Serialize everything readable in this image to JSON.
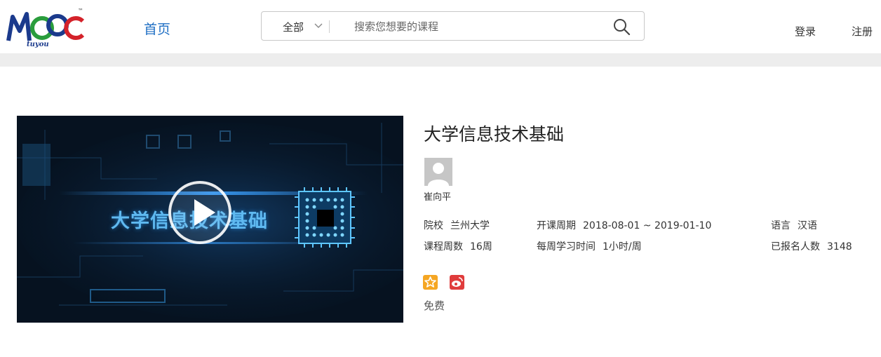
{
  "header": {
    "logo_text": "MOOC",
    "logo_sub": "tuyou",
    "logo_tm": "™",
    "nav_home": "首页",
    "search": {
      "scope": "全部",
      "placeholder": "搜索您想要的课程"
    },
    "login": "登录",
    "register": "注册"
  },
  "course": {
    "cover_title": "大学信息技术基础",
    "title": "大学信息技术基础",
    "teacher": "崔向平",
    "meta": [
      {
        "label": "院校",
        "value": "兰州大学"
      },
      {
        "label": "开课周期",
        "value": "2018-08-01 ~ 2019-01-10"
      },
      {
        "label": "语言",
        "value": "汉语"
      },
      {
        "label": "课程周数",
        "value": "16周"
      },
      {
        "label": "每周学习时间",
        "value": "1小时/周"
      },
      {
        "label": "已报名人数",
        "value": "3148"
      }
    ],
    "share_icons": [
      "star-share-icon",
      "weibo-icon"
    ],
    "price": "免费"
  },
  "colors": {
    "nav_blue": "#1f6fc4",
    "cover_bg": "#061220",
    "cover_text": "#5fb9f0",
    "share_orange": "#f5a623",
    "share_red": "#e03c3c",
    "header_bar": "#ededed"
  }
}
